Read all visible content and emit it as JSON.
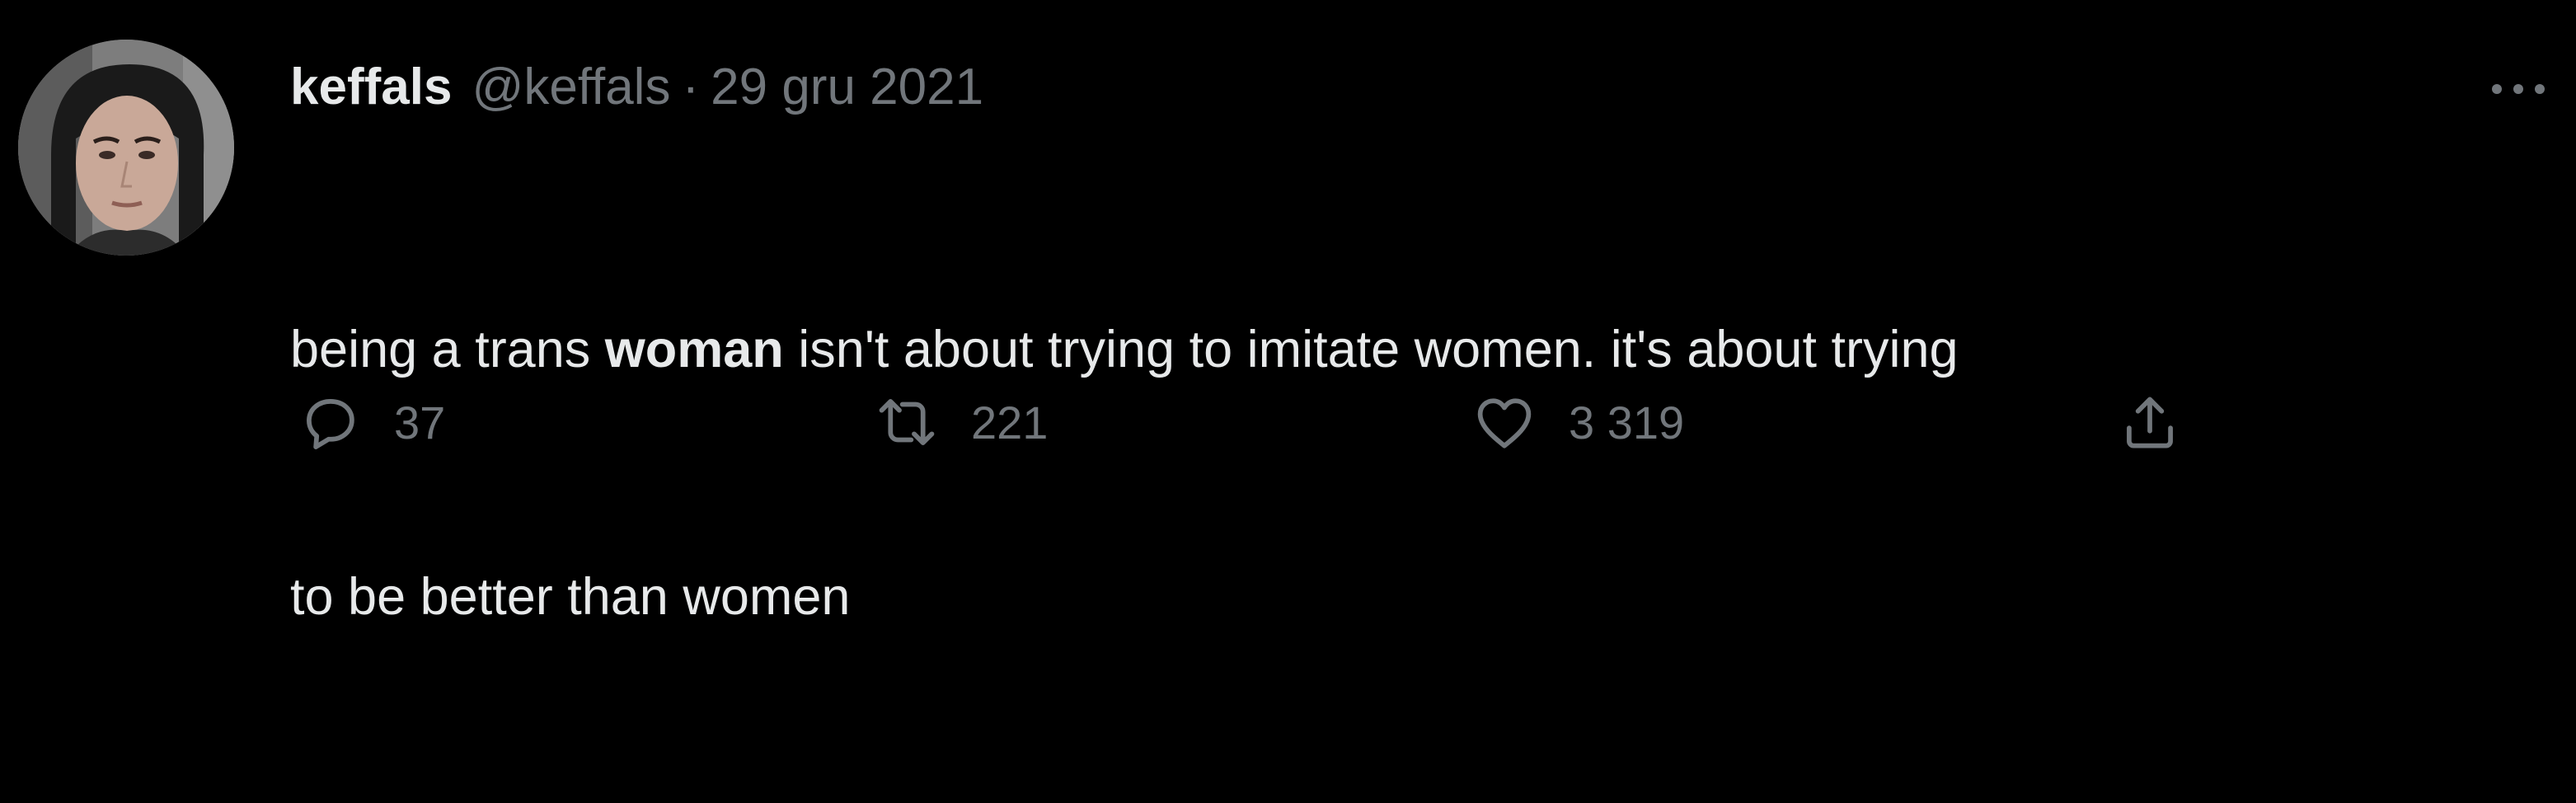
{
  "tweet": {
    "author": {
      "display_name": "keffals",
      "handle": "@keffals"
    },
    "separator": "·",
    "date": "29 gru 2021",
    "text": {
      "line1_before": "being a trans ",
      "line1_bold": "woman",
      "line1_after": " isn't about trying to imitate women. it's about trying",
      "line2": "to be better than women"
    },
    "actions": {
      "replies": "37",
      "retweets": "221",
      "likes": "3 319"
    }
  },
  "colors": {
    "background": "#000000",
    "primary_text": "#e7e9ea",
    "secondary_text": "#71767b"
  },
  "icons": {
    "avatar": "profile-photo",
    "more": "more-horizontal-icon",
    "reply": "reply-bubble-icon",
    "retweet": "retweet-icon",
    "like": "heart-icon",
    "share": "share-upload-icon"
  }
}
